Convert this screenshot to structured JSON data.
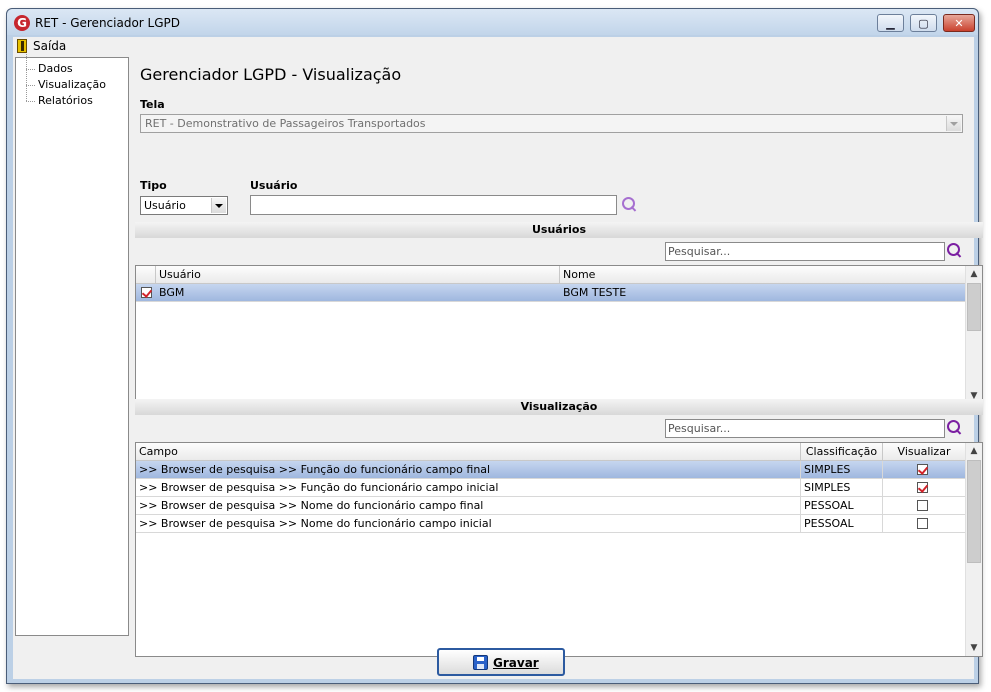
{
  "window": {
    "title": "RET - Gerenciador LGPD",
    "app_icon_letter": "G"
  },
  "menu": {
    "exit_label": "Saída"
  },
  "nav": {
    "items": [
      {
        "label": "Dados"
      },
      {
        "label": "Visualização"
      },
      {
        "label": "Relatórios"
      }
    ]
  },
  "main": {
    "title": "Gerenciador LGPD - Visualização",
    "tela": {
      "label": "Tela",
      "value": "RET -  Demonstrativo de Passageiros Transportados"
    },
    "tipo": {
      "label": "Tipo",
      "value": "Usuário"
    },
    "usuario": {
      "label": "Usuário",
      "value": ""
    }
  },
  "usuarios_section": {
    "title": "Usuários",
    "search_placeholder": "Pesquisar...",
    "columns": [
      "Usuário",
      "Nome"
    ],
    "rows": [
      {
        "checked": true,
        "usuario": "BGM",
        "nome": "BGM TESTE",
        "selected": true
      }
    ]
  },
  "visualizacao_section": {
    "title": "Visualização",
    "search_placeholder": "Pesquisar...",
    "columns": [
      "Campo",
      "Classificação",
      "Visualizar"
    ],
    "rows": [
      {
        "campo": ">> Browser de pesquisa >> Função do funcionário campo final",
        "classificacao": "SIMPLES",
        "visualizar": true,
        "selected": true
      },
      {
        "campo": ">> Browser de pesquisa >> Função do funcionário campo inicial",
        "classificacao": "SIMPLES",
        "visualizar": true,
        "selected": false
      },
      {
        "campo": ">> Browser de pesquisa >> Nome do funcionário campo final",
        "classificacao": "PESSOAL",
        "visualizar": false,
        "selected": false
      },
      {
        "campo": ">> Browser de pesquisa >> Nome do funcionário campo inicial",
        "classificacao": "PESSOAL",
        "visualizar": false,
        "selected": false
      }
    ]
  },
  "footer": {
    "save_label": "Gravar"
  },
  "colors": {
    "selection": "#b3c7e8",
    "search_icon": "#7b1fa2",
    "check_mark": "#d2232a",
    "button_border": "#2c5aa0"
  },
  "icons": [
    "app-logo-icon",
    "exit-door-icon",
    "search-icon",
    "floppy-disk-icon",
    "minimize-icon",
    "maximize-icon",
    "close-icon"
  ]
}
